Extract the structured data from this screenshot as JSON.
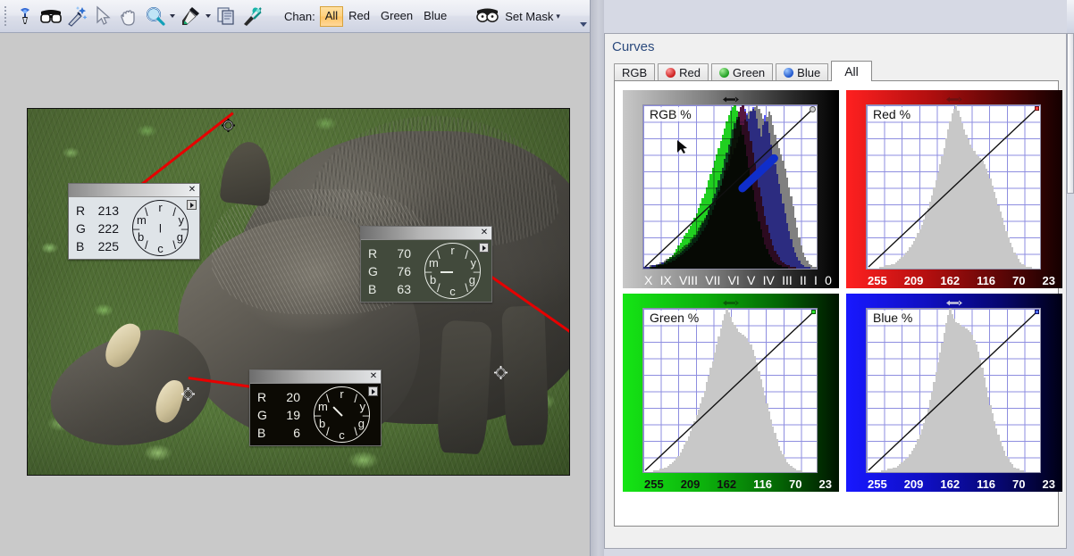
{
  "toolbar": {
    "tools": [
      {
        "name": "color-picker-pin-icon",
        "title": "Color Sampler"
      },
      {
        "name": "mask-glasses-icon",
        "title": "Mask"
      },
      {
        "name": "magic-wand-icon",
        "title": "Magic Wand"
      },
      {
        "name": "selection-arrow-icon",
        "title": "Select"
      },
      {
        "name": "hand-pan-icon",
        "title": "Pan"
      },
      {
        "name": "magnifier-zoom-icon",
        "title": "Zoom"
      },
      {
        "name": "eyedropper-icon",
        "title": "Eyedropper"
      },
      {
        "name": "copy-pages-icon",
        "title": "Copy"
      },
      {
        "name": "wrench-brush-icon",
        "title": "Adjust"
      }
    ],
    "chan_label": "Chan:",
    "chan_options": [
      "All",
      "Red",
      "Green",
      "Blue"
    ],
    "chan_selected": "All",
    "set_mask_label": "Set Mask",
    "set_mask_caret": "▾"
  },
  "curves": {
    "title": "Curves",
    "tabs": [
      {
        "label": "RGB",
        "dot": ""
      },
      {
        "label": "Red",
        "dot": "red"
      },
      {
        "label": "Green",
        "dot": "green"
      },
      {
        "label": "Blue",
        "dot": "blue"
      },
      {
        "label": "All",
        "dot": ""
      }
    ],
    "active_tab": "All"
  },
  "chart_data": [
    {
      "type": "area",
      "title": "RGB %",
      "panel": "rgb",
      "xlabel": "",
      "ylabel": "",
      "grid": true,
      "tick_labels": [
        "X",
        "IX",
        "VIII",
        "VII",
        "VI",
        "V",
        "IV",
        "III",
        "II",
        "I",
        "0"
      ],
      "curve": {
        "points": [
          [
            0,
            0
          ],
          [
            100,
            100
          ]
        ],
        "type": "linear-identity"
      },
      "series": [
        {
          "name": "luminosity",
          "color": "#808080",
          "values": [
            1,
            1,
            1,
            2,
            2,
            2,
            3,
            3,
            4,
            4,
            5,
            6,
            6,
            7,
            8,
            9,
            10,
            11,
            12,
            13,
            14,
            15,
            16,
            18,
            19,
            21,
            23,
            25,
            27,
            29,
            31,
            33,
            35,
            38,
            40,
            43,
            45,
            48,
            51,
            54,
            57,
            60,
            63,
            67,
            70,
            74,
            77,
            81,
            84,
            88,
            91,
            94,
            96,
            97,
            98,
            99,
            100,
            98,
            95,
            92,
            90,
            93,
            96,
            94,
            88,
            82,
            78,
            74,
            70,
            66,
            61,
            56,
            50,
            44,
            38,
            31,
            25,
            19,
            14,
            10,
            7,
            5,
            3,
            2,
            1,
            1
          ]
        },
        {
          "name": "red",
          "color": "#ff4040",
          "values": [
            0,
            0,
            0,
            0,
            1,
            1,
            1,
            2,
            2,
            2,
            3,
            3,
            4,
            4,
            5,
            5,
            6,
            7,
            8,
            9,
            10,
            11,
            12,
            13,
            14,
            16,
            17,
            19,
            21,
            23,
            25,
            27,
            30,
            33,
            36,
            39,
            43,
            47,
            51,
            55,
            60,
            65,
            70,
            75,
            80,
            86,
            91,
            96,
            99,
            100,
            96,
            90,
            84,
            78,
            71,
            64,
            57,
            50,
            44,
            38,
            32,
            27,
            22,
            18,
            14,
            11,
            9,
            7,
            5,
            4,
            3,
            2,
            2,
            1,
            1,
            1,
            0,
            0,
            0,
            0,
            0,
            0,
            0,
            0,
            0,
            0
          ]
        },
        {
          "name": "green",
          "color": "#20d020",
          "values": [
            0,
            0,
            0,
            1,
            1,
            1,
            2,
            2,
            3,
            3,
            4,
            5,
            6,
            7,
            8,
            10,
            12,
            14,
            16,
            18,
            20,
            22,
            24,
            26,
            29,
            31,
            34,
            37,
            40,
            43,
            46,
            50,
            54,
            58,
            62,
            66,
            70,
            74,
            78,
            82,
            86,
            90,
            94,
            97,
            99,
            100,
            97,
            93,
            88,
            82,
            76,
            69,
            62,
            55,
            48,
            41,
            35,
            29,
            24,
            19,
            15,
            12,
            9,
            7,
            5,
            4,
            3,
            2,
            2,
            1,
            1,
            1,
            0,
            0,
            0,
            0,
            0,
            0,
            0,
            0,
            0,
            0,
            0,
            0,
            0,
            0
          ]
        },
        {
          "name": "blue",
          "color": "#5858ff",
          "values": [
            1,
            1,
            1,
            1,
            2,
            2,
            2,
            3,
            3,
            4,
            4,
            5,
            5,
            6,
            7,
            7,
            8,
            9,
            10,
            11,
            12,
            13,
            15,
            16,
            18,
            19,
            21,
            23,
            25,
            28,
            30,
            33,
            36,
            39,
            43,
            46,
            50,
            54,
            58,
            62,
            67,
            71,
            76,
            80,
            85,
            89,
            93,
            96,
            99,
            100,
            98,
            95,
            92,
            96,
            99,
            97,
            92,
            86,
            81,
            88,
            94,
            90,
            83,
            76,
            70,
            64,
            58,
            52,
            46,
            40,
            34,
            28,
            23,
            18,
            13,
            10,
            7,
            5,
            3,
            2,
            1,
            1,
            1,
            0,
            0,
            0
          ]
        }
      ]
    },
    {
      "type": "area",
      "title": "Red %",
      "panel": "red",
      "grid": true,
      "tick_labels": [
        "255",
        "209",
        "162",
        "116",
        "70",
        "23"
      ],
      "curve": {
        "points": [
          [
            0,
            0
          ],
          [
            100,
            100
          ]
        ],
        "type": "linear-identity"
      },
      "series": [
        {
          "name": "red-histogram",
          "color": "#c8c8c8",
          "values": [
            0,
            0,
            0,
            0,
            0,
            0,
            1,
            1,
            1,
            2,
            2,
            2,
            3,
            3,
            4,
            5,
            6,
            7,
            8,
            10,
            11,
            13,
            15,
            17,
            19,
            22,
            24,
            27,
            30,
            34,
            37,
            41,
            45,
            50,
            54,
            59,
            64,
            69,
            74,
            80,
            85,
            90,
            95,
            98,
            100,
            97,
            93,
            89,
            85,
            82,
            79,
            76,
            74,
            72,
            70,
            69,
            68,
            66,
            64,
            61,
            58,
            55,
            51,
            47,
            43,
            39,
            35,
            31,
            27,
            23,
            19,
            16,
            13,
            10,
            8,
            6,
            4,
            3,
            2,
            1,
            1,
            1,
            0,
            0,
            0,
            0
          ]
        }
      ]
    },
    {
      "type": "area",
      "title": "Green %",
      "panel": "green",
      "grid": true,
      "tick_labels": [
        "255",
        "209",
        "162",
        "116",
        "70",
        "23"
      ],
      "curve": {
        "points": [
          [
            0,
            0
          ],
          [
            100,
            100
          ]
        ],
        "type": "linear-identity"
      },
      "series": [
        {
          "name": "green-histogram",
          "color": "#c8c8c8",
          "values": [
            0,
            0,
            0,
            0,
            0,
            1,
            1,
            1,
            2,
            2,
            3,
            3,
            4,
            5,
            6,
            7,
            9,
            10,
            12,
            14,
            17,
            19,
            22,
            25,
            28,
            31,
            35,
            38,
            42,
            46,
            50,
            55,
            59,
            64,
            68,
            73,
            78,
            83,
            88,
            93,
            97,
            100,
            98,
            95,
            92,
            90,
            88,
            86,
            85,
            84,
            83,
            82,
            80,
            78,
            75,
            71,
            67,
            62,
            57,
            52,
            47,
            42,
            37,
            32,
            28,
            24,
            20,
            16,
            13,
            11,
            8,
            6,
            5,
            4,
            3,
            2,
            1,
            1,
            1,
            0,
            0,
            0,
            0,
            0,
            0,
            0
          ]
        }
      ]
    },
    {
      "type": "area",
      "title": "Blue %",
      "panel": "blue",
      "grid": true,
      "tick_labels": [
        "255",
        "209",
        "162",
        "116",
        "70",
        "23"
      ],
      "curve": {
        "points": [
          [
            0,
            0
          ],
          [
            100,
            100
          ]
        ],
        "type": "linear-identity"
      },
      "series": [
        {
          "name": "blue-histogram",
          "color": "#c8c8c8",
          "values": [
            0,
            0,
            0,
            0,
            0,
            0,
            0,
            1,
            1,
            1,
            2,
            2,
            2,
            3,
            3,
            4,
            5,
            6,
            7,
            8,
            9,
            11,
            13,
            15,
            17,
            20,
            23,
            26,
            30,
            34,
            39,
            44,
            49,
            55,
            61,
            67,
            73,
            79,
            85,
            91,
            96,
            100,
            97,
            94,
            92,
            91,
            90,
            89,
            89,
            88,
            87,
            86,
            84,
            81,
            78,
            74,
            69,
            64,
            58,
            52,
            46,
            41,
            36,
            31,
            27,
            23,
            19,
            16,
            13,
            10,
            8,
            6,
            5,
            3,
            2,
            2,
            1,
            1,
            0,
            0,
            0,
            0,
            0,
            0,
            0,
            0
          ]
        }
      ]
    }
  ],
  "samples": [
    {
      "id": "sample-1",
      "r_label": "R",
      "r_value": "213",
      "g_label": "G",
      "g_value": "222",
      "b_label": "B",
      "b_value": "225",
      "wheel": {
        "r": "r",
        "y": "y",
        "g": "g",
        "c": "c",
        "b": "b",
        "m": "m",
        "center": "l"
      },
      "close_glyph": "✕"
    },
    {
      "id": "sample-2",
      "r_label": "R",
      "r_value": "70",
      "g_label": "G",
      "g_value": "76",
      "b_label": "B",
      "b_value": "63",
      "wheel": {
        "r": "r",
        "y": "y",
        "g": "g",
        "c": "c",
        "b": "b",
        "m": "m",
        "center": ""
      },
      "close_glyph": "✕"
    },
    {
      "id": "sample-3",
      "r_label": "R",
      "r_value": "20",
      "g_label": "G",
      "g_value": "19",
      "b_label": "B",
      "b_value": "6",
      "wheel": {
        "r": "r",
        "y": "y",
        "g": "g",
        "c": "c",
        "b": "b",
        "m": "m",
        "center": ""
      },
      "close_glyph": "✕"
    }
  ]
}
